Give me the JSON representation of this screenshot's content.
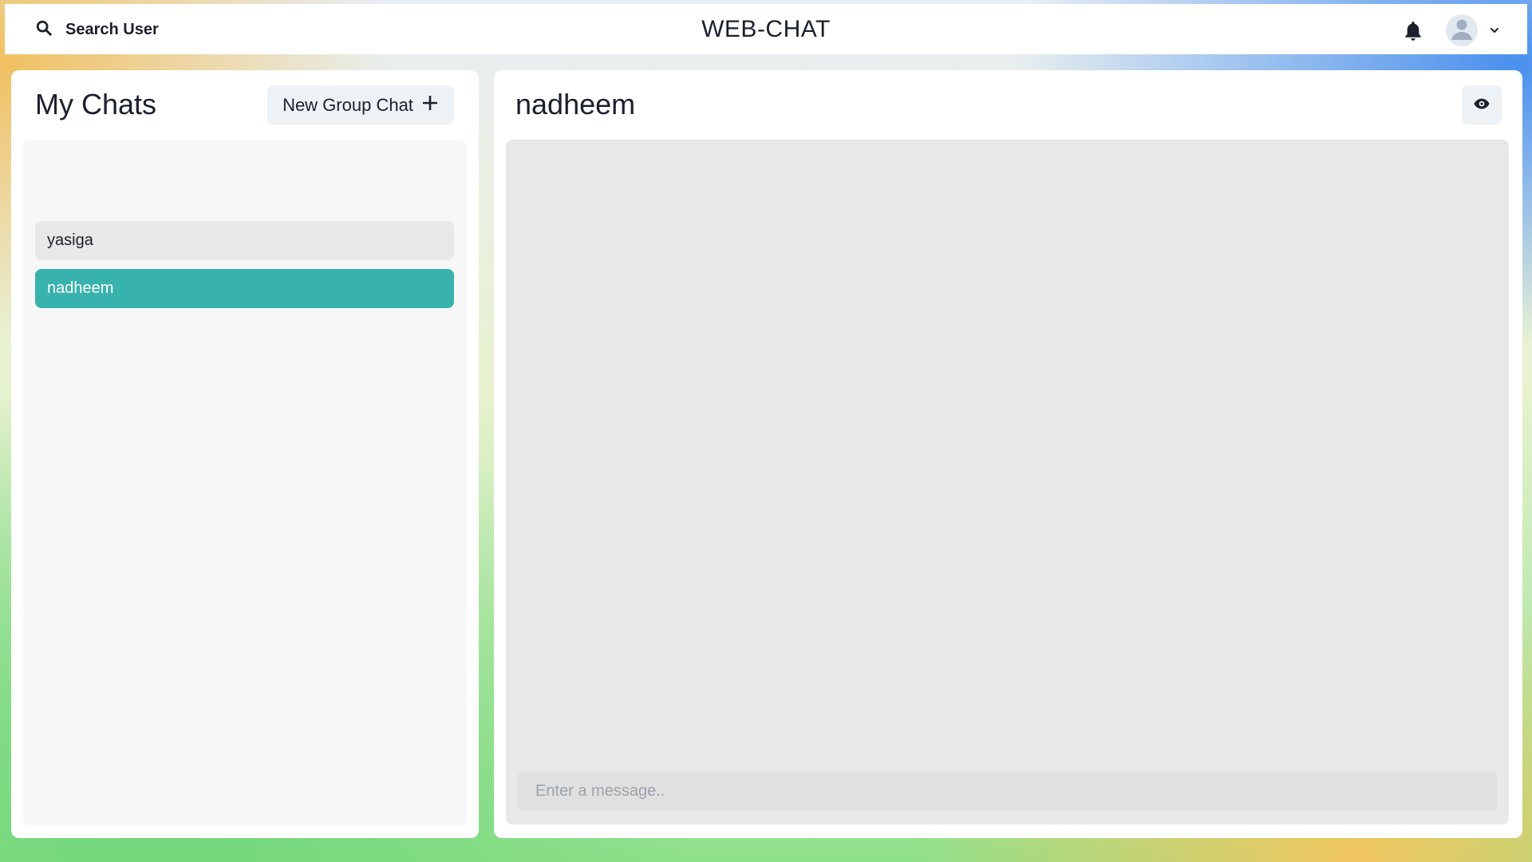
{
  "header": {
    "search_label": "Search User",
    "app_title": "WEB-CHAT",
    "icons": [
      "search-icon",
      "bell-icon",
      "user-avatar-icon",
      "chevron-down-icon"
    ]
  },
  "sidebar": {
    "title": "My Chats",
    "new_group_label": "New Group Chat",
    "chats": [
      {
        "name": "yasiga",
        "selected": false
      },
      {
        "name": "nadheem",
        "selected": true
      }
    ],
    "accent_color": "#38b2ac"
  },
  "conversation": {
    "title": "nadheem",
    "message_input": {
      "value": "",
      "placeholder": "Enter a message.."
    },
    "icons": [
      "eye-icon"
    ]
  }
}
